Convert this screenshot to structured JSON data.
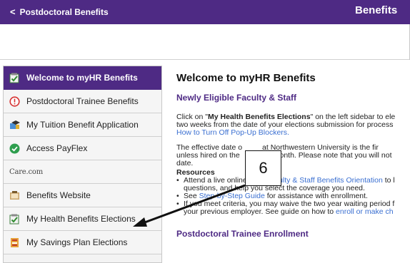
{
  "header": {
    "back_label": "Postdoctoral Benefits",
    "back_glyph": "<",
    "title": "Benefits",
    "bar_color": "#4e2a84"
  },
  "sidebar": {
    "items": [
      {
        "label": "Welcome to myHR Benefits",
        "icon": "checklist-icon",
        "active": true
      },
      {
        "label": "Postdoctoral Trainee Benefits",
        "icon": "alert-icon"
      },
      {
        "label": "My Tuition Benefit Application",
        "icon": "graduation-icon"
      },
      {
        "label": "Access PayFlex",
        "icon": "check-circle-icon"
      },
      {
        "label": "Care.com",
        "icon": "care-logo"
      },
      {
        "label": "Benefits Website",
        "icon": "book-icon"
      },
      {
        "label": "My Health Benefits Elections",
        "icon": "checklist-icon"
      },
      {
        "label": "My Savings Plan Elections",
        "icon": "savings-icon"
      }
    ]
  },
  "main": {
    "title": "Welcome to myHR Benefits",
    "section1": "Newly Eligible Faculty & Staff",
    "p1_pre": "Click on \"",
    "p1_bold": "My Health Benefits Elections",
    "p1_post": "\" on the left sidebar to ele",
    "p1_line2": "two weeks from the date of your elections submission for process",
    "p1_link": "How to Turn Off Pop-Up Blockers.",
    "p2_line1a": "The effective date o",
    "p2_line1b": "at Northwestern University is the fir",
    "p2_line2a": "unless hired on the",
    "p2_line2b": "month. Please note that you will not",
    "p2_line3": "date.",
    "resources": "Resources",
    "b1_pre": "Attend a live online ",
    "b1_link": "New Faculty & Staff Benefits Orientation",
    "b1_post": " to l",
    "b1_line2": "questions, and help you select the coverage you need.",
    "b2_pre": "See ",
    "b2_link": "Step-by-Step Guide",
    "b2_post": " for assistance with enrollment.",
    "b3_line1": "If you meet criteria, you may waive the two year waiting period f",
    "b3_line2_pre": "your previous employer. See guide on how to ",
    "b3_link": "enroll or make ch",
    "section2": "Postdoctoral Trainee Enrollment"
  },
  "annotation": {
    "step_number": "6"
  }
}
